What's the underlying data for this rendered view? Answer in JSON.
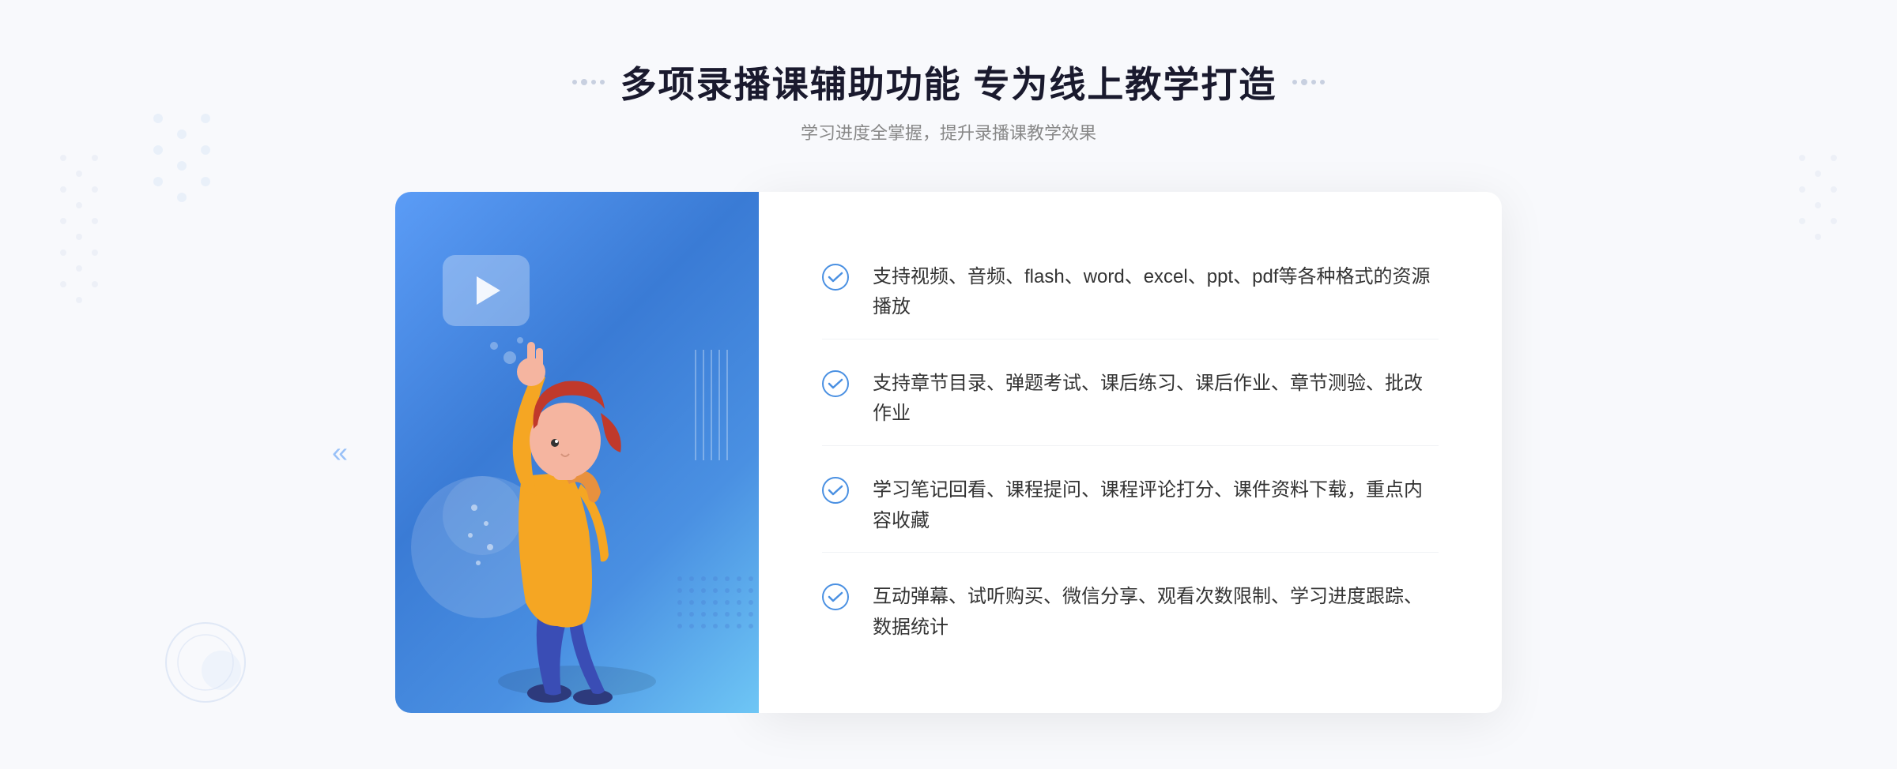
{
  "page": {
    "background": "#f5f7fb"
  },
  "header": {
    "title": "多项录播课辅助功能 专为线上教学打造",
    "subtitle": "学习进度全掌握，提升录播课教学效果"
  },
  "features": [
    {
      "id": 1,
      "text": "支持视频、音频、flash、word、excel、ppt、pdf等各种格式的资源播放"
    },
    {
      "id": 2,
      "text": "支持章节目录、弹题考试、课后练习、课后作业、章节测验、批改作业"
    },
    {
      "id": 3,
      "text": "学习笔记回看、课程提问、课程评论打分、课件资料下载，重点内容收藏"
    },
    {
      "id": 4,
      "text": "互动弹幕、试听购买、微信分享、观看次数限制、学习进度跟踪、数据统计"
    }
  ],
  "icons": {
    "check": "✓",
    "left_arrows": "«",
    "play": "▶"
  }
}
